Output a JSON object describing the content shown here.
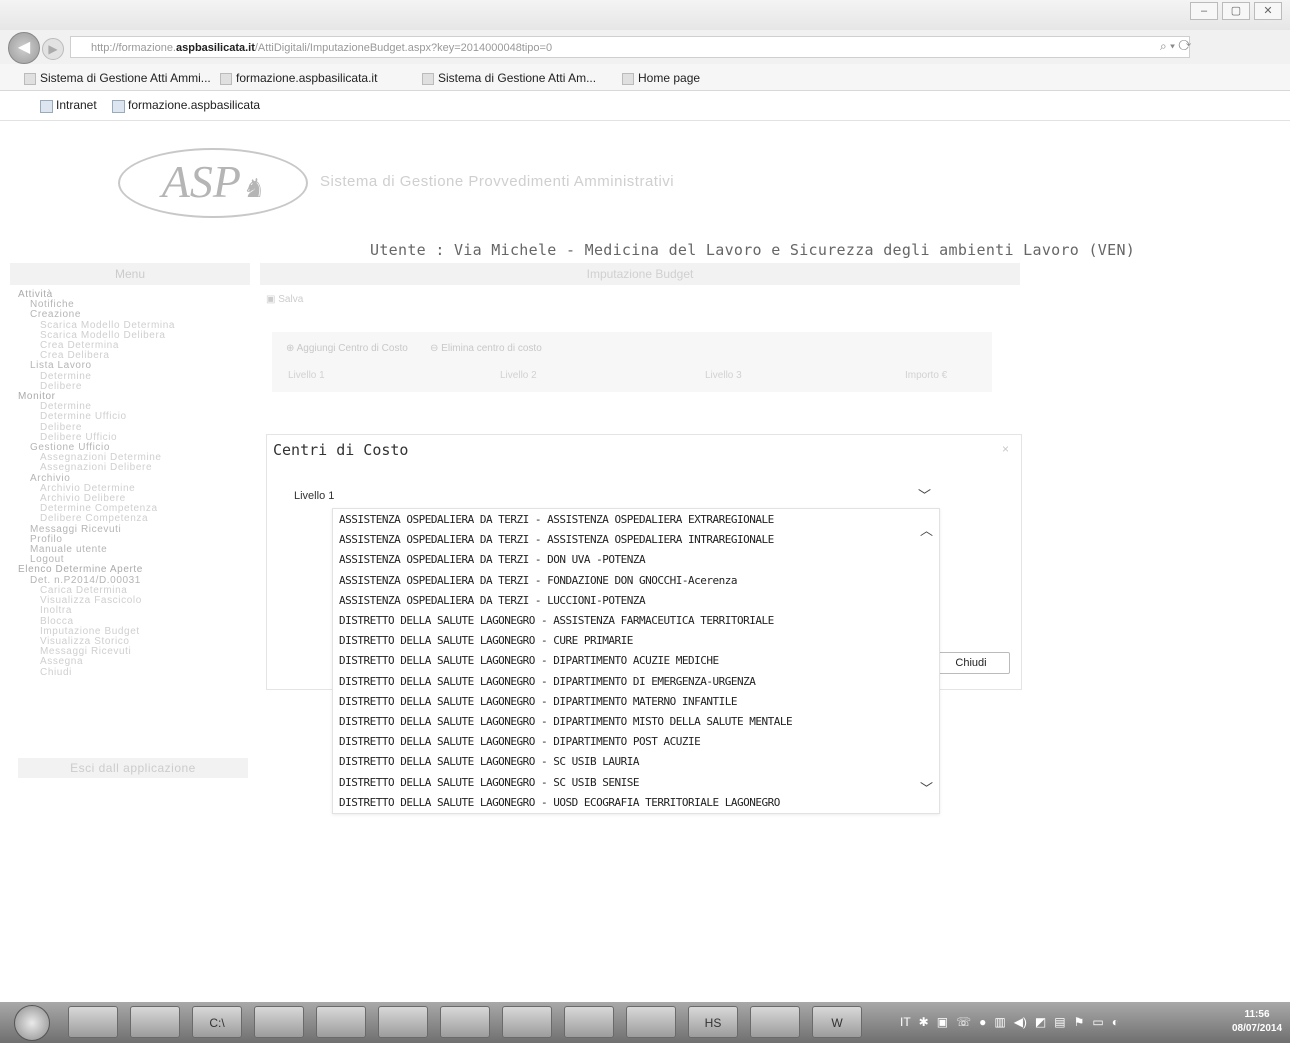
{
  "browser": {
    "url_prefix": "http://formazione.",
    "url_domain": "aspbasilicata.it",
    "url_path": "/AttiDigitali/ImputazioneBudget.aspx?key=2014000048tipo=0",
    "window_controls": [
      "–",
      "▢",
      "✕"
    ],
    "tabs": [
      {
        "label": "Sistema di Gestione Atti Ammi..."
      },
      {
        "label": "formazione.aspbasilicata.it"
      },
      {
        "label": "Sistema di Gestione Atti Am..."
      },
      {
        "label": "Home page"
      }
    ],
    "favorites": [
      {
        "label": "Intranet"
      },
      {
        "label": "formazione.aspbasilicata"
      }
    ]
  },
  "header": {
    "logo_text": "ASP",
    "app_title": "Sistema di Gestione Provvedimenti Amministrativi",
    "user_line": "Utente : Via Michele - Medicina del Lavoro e Sicurezza degli ambienti Lavoro (VEN)",
    "menu_label": "Menu",
    "section_label": "Imputazione Budget"
  },
  "sidebar": {
    "items": [
      {
        "label": "Attività",
        "level": 0
      },
      {
        "label": "Notifiche",
        "level": 1
      },
      {
        "label": "Creazione",
        "level": 1
      },
      {
        "label": "Scarica Modello Determina",
        "level": 2
      },
      {
        "label": "Scarica Modello Delibera",
        "level": 2
      },
      {
        "label": "Crea Determina",
        "level": 2
      },
      {
        "label": "Crea Delibera",
        "level": 2
      },
      {
        "label": "Lista Lavoro",
        "level": 1
      },
      {
        "label": "Determine",
        "level": 2
      },
      {
        "label": "Delibere",
        "level": 2
      },
      {
        "label": "Monitor",
        "level": 0
      },
      {
        "label": "Determine",
        "level": 2
      },
      {
        "label": "Determine Ufficio",
        "level": 2
      },
      {
        "label": "Delibere",
        "level": 2
      },
      {
        "label": "Delibere Ufficio",
        "level": 2
      },
      {
        "label": "Gestione Ufficio",
        "level": 1
      },
      {
        "label": "Assegnazioni Determine",
        "level": 2
      },
      {
        "label": "Assegnazioni Delibere",
        "level": 2
      },
      {
        "label": "Archivio",
        "level": 1
      },
      {
        "label": "Archivio Determine",
        "level": 2
      },
      {
        "label": "Archivio Delibere",
        "level": 2
      },
      {
        "label": "Determine Competenza",
        "level": 2
      },
      {
        "label": "Delibere Competenza",
        "level": 2
      },
      {
        "label": "Messaggi Ricevuti",
        "level": 1
      },
      {
        "label": "Profilo",
        "level": 1
      },
      {
        "label": "Manuale utente",
        "level": 1
      },
      {
        "label": "Logout",
        "level": 1
      },
      {
        "label": "Elenco Determine Aperte",
        "level": 0
      },
      {
        "label": "Det. n.P2014/D.00031",
        "level": 1
      },
      {
        "label": "Carica Determina",
        "level": 2
      },
      {
        "label": "Visualizza Fascicolo",
        "level": 2
      },
      {
        "label": "Inoltra",
        "level": 2
      },
      {
        "label": "Blocca",
        "level": 2
      },
      {
        "label": "Imputazione Budget",
        "level": 2
      },
      {
        "label": "Visualizza Storico",
        "level": 2
      },
      {
        "label": "Messaggi Ricevuti",
        "level": 2
      },
      {
        "label": "Assegna",
        "level": 2
      },
      {
        "label": "Chiudi",
        "level": 2
      }
    ],
    "exit_label": "Esci dall applicazione"
  },
  "main": {
    "save_label": "Salva",
    "add_cost_label": "Aggiungi Centro di Costo",
    "delete_cost_label": "Elimina centro di costo",
    "columns": [
      "Livello 1",
      "Livello 2",
      "Livello 3",
      "Importo €"
    ]
  },
  "dialog": {
    "title": "Centri di Costo",
    "close_glyph": "×",
    "field_label": "Livello 1",
    "close_button": "Chiudi",
    "options": [
      "ASSISTENZA OSPEDALIERA DA TERZI - ASSISTENZA OSPEDALIERA EXTRAREGIONALE",
      "ASSISTENZA OSPEDALIERA DA TERZI - ASSISTENZA OSPEDALIERA INTRAREGIONALE",
      "ASSISTENZA OSPEDALIERA DA TERZI - DON UVA -POTENZA",
      "ASSISTENZA OSPEDALIERA DA TERZI - FONDAZIONE DON GNOCCHI-Acerenza",
      "ASSISTENZA OSPEDALIERA DA TERZI - LUCCIONI-POTENZA",
      "DISTRETTO DELLA SALUTE LAGONEGRO - ASSISTENZA FARMACEUTICA TERRITORIALE",
      "DISTRETTO DELLA SALUTE LAGONEGRO - CURE PRIMARIE",
      "DISTRETTO DELLA SALUTE LAGONEGRO - DIPARTIMENTO ACUZIE MEDICHE",
      "DISTRETTO DELLA SALUTE LAGONEGRO - DIPARTIMENTO DI EMERGENZA-URGENZA",
      "DISTRETTO DELLA SALUTE LAGONEGRO - DIPARTIMENTO MATERNO INFANTILE",
      "DISTRETTO DELLA SALUTE LAGONEGRO - DIPARTIMENTO MISTO DELLA SALUTE MENTALE",
      "DISTRETTO DELLA SALUTE LAGONEGRO - DIPARTIMENTO POST ACUZIE",
      "DISTRETTO DELLA SALUTE LAGONEGRO - SC USIB LAURIA",
      "DISTRETTO DELLA SALUTE LAGONEGRO - SC USIB SENISE",
      "DISTRETTO DELLA SALUTE LAGONEGRO - UOSD ECOGRAFIA TERRITORIALE LAGONEGRO"
    ]
  },
  "taskbar": {
    "apps": [
      {
        "icon": "firefox-icon",
        "label": ""
      },
      {
        "icon": "chrome-icon",
        "label": ""
      },
      {
        "icon": "cmd-icon",
        "label": "C:\\"
      },
      {
        "icon": "explorer-icon",
        "label": ""
      },
      {
        "icon": "app-icon",
        "label": ""
      },
      {
        "icon": "app-icon",
        "label": ""
      },
      {
        "icon": "app-icon",
        "label": ""
      },
      {
        "icon": "network-icon",
        "label": ""
      },
      {
        "icon": "tools-icon",
        "label": ""
      },
      {
        "icon": "settings-icon",
        "label": ""
      },
      {
        "icon": "hs-icon",
        "label": "HS"
      },
      {
        "icon": "app-icon",
        "label": ""
      },
      {
        "icon": "word-icon",
        "label": "W"
      }
    ],
    "language": "IT",
    "time": "11:56",
    "date": "08/07/2014"
  }
}
